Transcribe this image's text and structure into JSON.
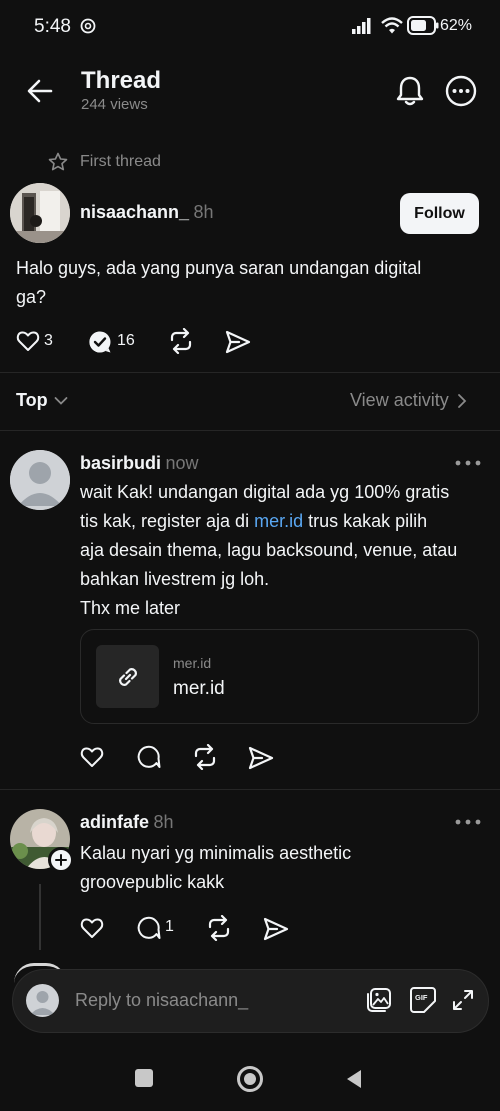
{
  "status_bar": {
    "time": "5:48",
    "battery": "62%"
  },
  "header": {
    "title": "Thread",
    "views": "244 views"
  },
  "first_thread": {
    "label": "First thread"
  },
  "post": {
    "username": "nisaachann_",
    "time": "8h",
    "follow_label": "Follow",
    "text_line1": "Halo guys, ada yang punya saran undangan digital",
    "text_line2": "ga?",
    "likes": "3",
    "replies": "16"
  },
  "sort": {
    "label": "Top",
    "view_activity": "View activity"
  },
  "replies": [
    {
      "username": "basirbudi",
      "time": "now",
      "line1": "wait Kak! undangan digital ada yg 100% gratis",
      "line2_pre": "tis kak, register aja di ",
      "line2_link": "mer.id",
      "line2_post": " trus kakak pilih",
      "line3": "aja desain thema, lagu backsound, venue, atau",
      "line4": "bahkan livestrem jg loh.",
      "line5": "Thx me later",
      "card_domain": "mer.id",
      "card_title": "mer.id"
    },
    {
      "username": "adinfafe",
      "time": "8h",
      "line1": "Kalau nyari yg minimalis aesthetic",
      "line2": "groovepublic kakk",
      "replies": "1"
    }
  ],
  "reply_bar": {
    "placeholder": "Reply to nisaachann_"
  },
  "icons": [
    "back-arrow-icon",
    "bell-icon",
    "more-icon",
    "star-icon",
    "heart-icon",
    "reply-icon",
    "repost-icon",
    "share-icon",
    "link-icon",
    "gallery-icon",
    "gif-icon",
    "expand-icon",
    "plus-icon"
  ]
}
